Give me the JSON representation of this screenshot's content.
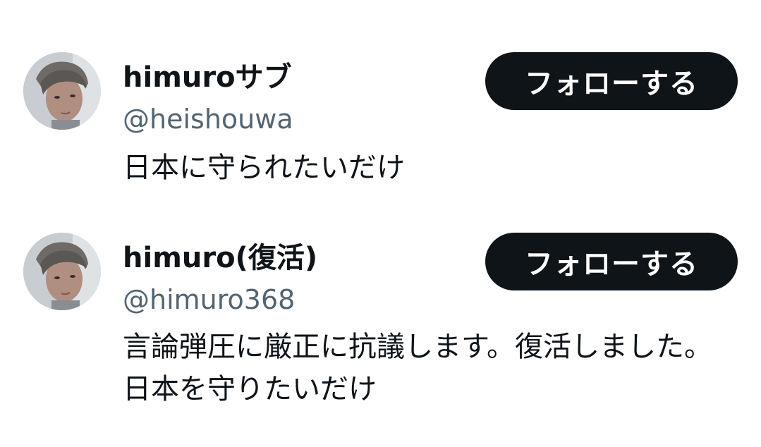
{
  "users": [
    {
      "display_name": "himuroサブ",
      "handle": "@heishouwa",
      "bio": "日本に守られたいだけ",
      "follow_label": "フォローする"
    },
    {
      "display_name": "himuro(復活)",
      "handle": "@himuro368",
      "bio": "言論弾圧に厳正に抗議します。復活しました。日本を守りたいだけ",
      "follow_label": "フォローする"
    }
  ],
  "colors": {
    "text_primary": "#0f1419",
    "text_secondary": "#536471",
    "button_bg": "#0f1419",
    "button_text": "#ffffff",
    "background": "#ffffff"
  }
}
